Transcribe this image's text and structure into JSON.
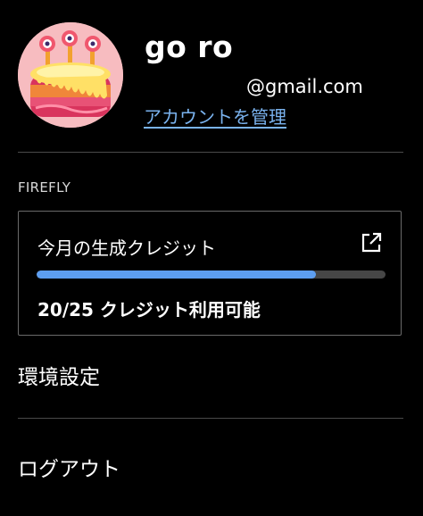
{
  "profile": {
    "name": "go ro",
    "email": "@gmail.com",
    "manage_account_link": "アカウントを管理",
    "avatar_icon": "birthday-cake-avatar",
    "link_color": "#7ab3ef"
  },
  "firefly": {
    "section_label": "FIREFLY",
    "credits_title": "今月の生成クレジット",
    "open_icon": "external-link-icon",
    "credits_used_fraction": 0.8,
    "credits_available_text": "20/25 クレジット利用可能",
    "progress_color": "#5d9ef0"
  },
  "menu": {
    "settings_label": "環境設定",
    "logout_label": "ログアウト"
  }
}
